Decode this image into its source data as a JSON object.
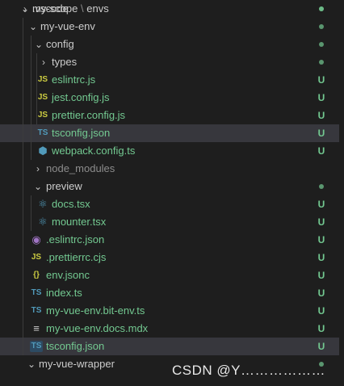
{
  "explorer": {
    "rows": [
      {
        "label": ".vscode"
      },
      {
        "label_a": "my-scope",
        "label_sep": "\\",
        "label_b": "envs"
      },
      {
        "label": "my-vue-env"
      },
      {
        "label": "config"
      },
      {
        "label": "types"
      },
      {
        "label": "eslintrc.js",
        "icon": "JS",
        "status": "U"
      },
      {
        "label": "jest.config.js",
        "icon": "JS",
        "status": "U"
      },
      {
        "label": "prettier.config.js",
        "icon": "JS",
        "status": "U"
      },
      {
        "label": "tsconfig.json",
        "icon": "TS",
        "status": "U"
      },
      {
        "label": "webpack.config.ts",
        "icon": "⬢",
        "status": "U"
      },
      {
        "label": "node_modules"
      },
      {
        "label": "preview"
      },
      {
        "label": "docs.tsx",
        "icon": "⚛",
        "status": "U"
      },
      {
        "label": "mounter.tsx",
        "icon": "⚛",
        "status": "U"
      },
      {
        "label": ".eslintrc.json",
        "icon": "◉",
        "status": "U"
      },
      {
        "label": ".prettierrc.cjs",
        "icon": "JS",
        "status": "U"
      },
      {
        "label": "env.jsonc",
        "icon": "{}",
        "status": "U"
      },
      {
        "label": "index.ts",
        "icon": "TS",
        "status": "U"
      },
      {
        "label": "my-vue-env.bit-env.ts",
        "icon": "TS",
        "status": "U"
      },
      {
        "label": "my-vue-env.docs.mdx",
        "icon": "≡",
        "status": "U"
      },
      {
        "label": "tsconfig.json",
        "icon": "TS",
        "status": "U"
      },
      {
        "label": "my-vue-wrapper"
      }
    ]
  },
  "chevrons": {
    "right": "›",
    "down": "⌄"
  },
  "watermark": "CSDN @Y………………"
}
